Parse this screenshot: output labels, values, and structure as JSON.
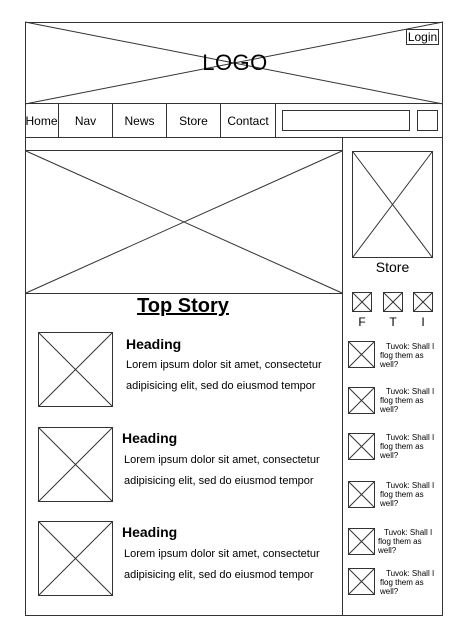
{
  "header": {
    "logo_text": "LOGO",
    "login_label": "Login"
  },
  "nav": {
    "items": [
      "Home",
      "Nav",
      "News",
      "Store",
      "Contact"
    ],
    "search_value": ""
  },
  "main": {
    "top_story": "Top Story",
    "articles": [
      {
        "heading": "Heading",
        "line1": "Lorem ipsum dolor sit amet, consectetur",
        "line2": "adipisicing elit, sed do eiusmod tempor"
      },
      {
        "heading": "Heading",
        "line1": "Lorem ipsum dolor sit amet, consectetur",
        "line2": "adipisicing elit, sed do eiusmod tempor"
      },
      {
        "heading": "Heading",
        "line1": "Lorem ipsum dolor sit amet, consectetur",
        "line2": "adipisicing elit, sed do eiusmod tempor"
      }
    ]
  },
  "sidebar": {
    "store_label": "Store",
    "social": [
      "F",
      "T",
      "I"
    ],
    "comments": [
      {
        "text": "Tuvok: Shall I flog them as well?"
      },
      {
        "text": "Tuvok: Shall I flog them as well?"
      },
      {
        "text": "Tuvok: Shall I flog them as well?"
      },
      {
        "text": "Tuvok: Shall I flog them as well?"
      },
      {
        "text": "Tuvok: Shall I flog them as well?"
      },
      {
        "text": "Tuvok: Shall I flog them as well?"
      }
    ]
  }
}
